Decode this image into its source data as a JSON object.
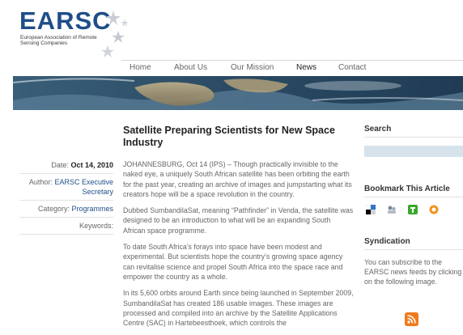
{
  "logo": {
    "title": "EARSC",
    "subtitle": "European Association of Remote Sensing Companies"
  },
  "nav": {
    "items": [
      "Home",
      "About Us",
      "Our Mission",
      "News",
      "Contact"
    ],
    "active": "News"
  },
  "meta": {
    "date_label": "Date:",
    "date_value": "Oct 14, 2010",
    "author_label": "Author:",
    "author_value": "EARSC Executive Secretary",
    "category_label": "Category:",
    "category_value": "Programmes",
    "keywords_label": "Keywords:"
  },
  "article": {
    "title": "Satellite Preparing Scientists for New Space Industry",
    "paragraphs": [
      "JOHANNESBURG, Oct 14 (IPS) – Though practically invisible to the naked eye, a uniquely South African satellite has been orbiting the earth for the past year, creating an archive of images and jumpstarting what its creators hope will be a space revolution in the country.",
      "Dubbed SumbandilaSat, meaning “Pathfinder” in Venda, the satellite was designed to be an introduction to what will be an expanding South African space programme.",
      "To date South Africa’s forays into space have been modest and experimental. But scientists hope the country’s growing space agency can revitalise science and propel South Africa into the space race and empower the country as a whole.",
      "In its 5,600 orbits around Earth since being launched in September 2009, SumbandilaSat has created 186 usable images. These images are processed and compiled into an archive by the Satellite Applications Centre (SAC) in Hartebeesthoek, which controls the"
    ]
  },
  "sidebar": {
    "search_heading": "Search",
    "bookmark_heading": "Bookmark This Article",
    "bookmark_icons": [
      "delicious-icon",
      "digg-icon",
      "technorati-icon",
      "stumbleupon-icon"
    ],
    "syndication_heading": "Syndication",
    "syndication_text": "You can subscribe to the EARSC news feeds by clicking on the following image."
  },
  "colors": {
    "brand_blue": "#1f4e89",
    "rss_orange": "#f07a1e"
  }
}
